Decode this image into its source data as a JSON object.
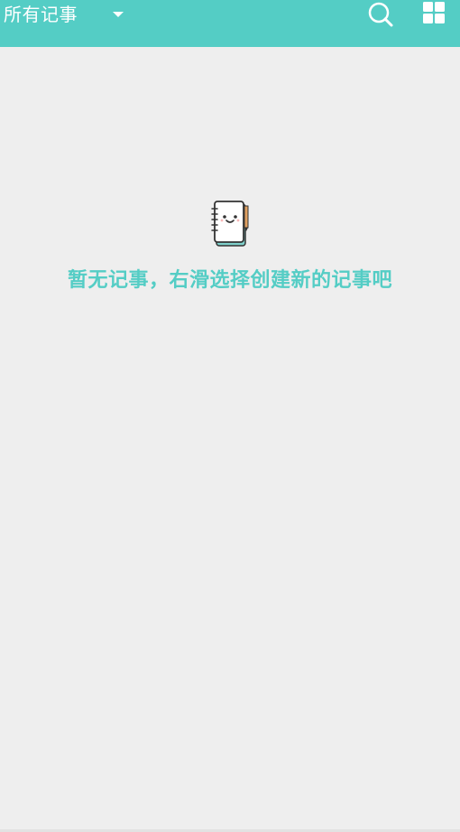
{
  "appbar": {
    "title": "所有记事",
    "bg_color": "#54cdc5",
    "dropdown_icon": "caret-down-icon",
    "search_icon": "search-icon",
    "grid_icon": "grid-view-icon"
  },
  "empty_state": {
    "icon": "notebook-icon",
    "message": "暂无记事，右滑选择创建新的记事吧",
    "text_color": "#54cdc5"
  },
  "background_color": "#eeeeee"
}
